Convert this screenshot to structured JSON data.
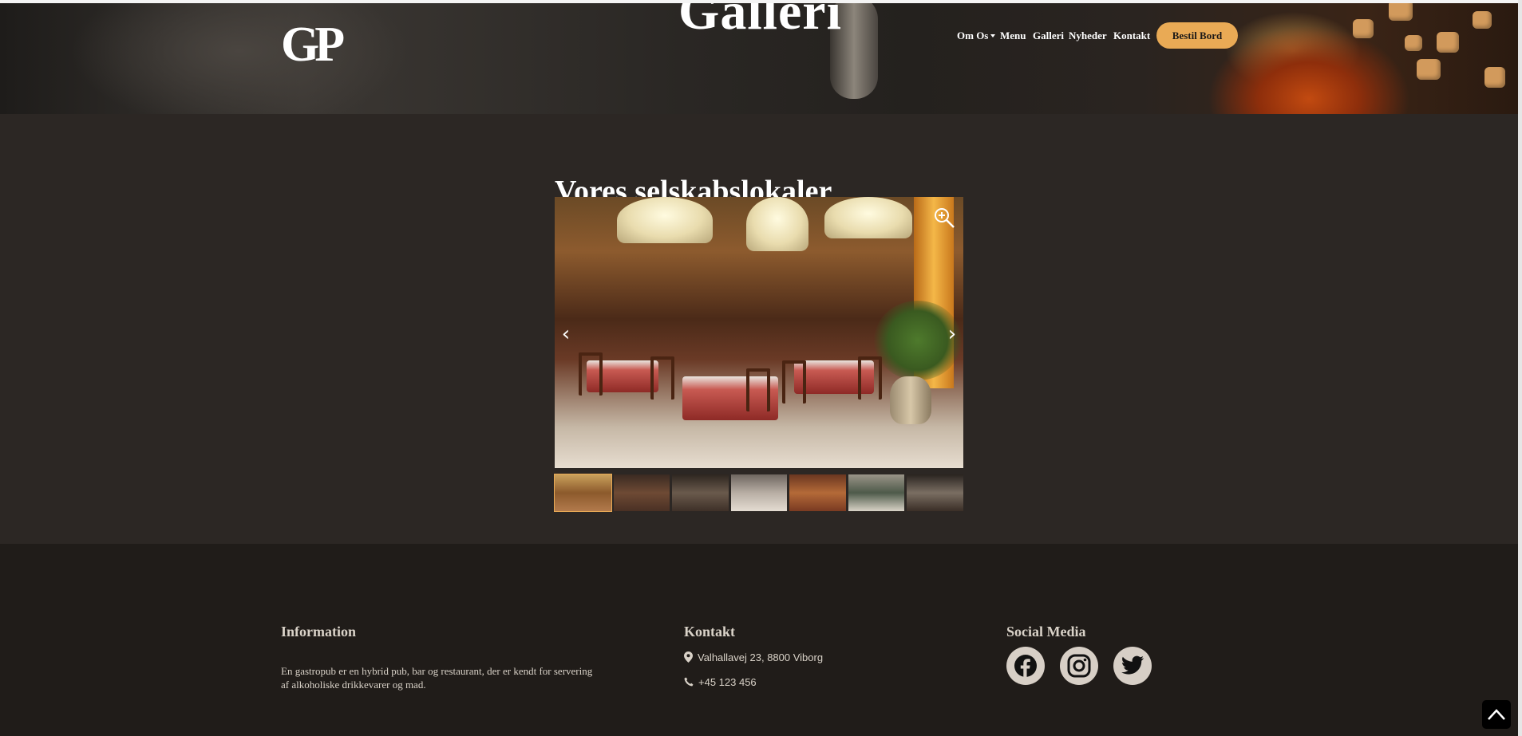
{
  "header": {
    "logo_text": "GP",
    "page_title": "Galleri",
    "nav": [
      {
        "label": "Om Os",
        "has_dropdown": true
      },
      {
        "label": "Menu"
      },
      {
        "label": "Galleri"
      },
      {
        "label": "Nyheder"
      },
      {
        "label": "Kontakt"
      }
    ],
    "cta_label": "Bestil Bord",
    "cta_color": "#e9aa55"
  },
  "gallery": {
    "title": "Vores selskabslokaler",
    "thumbnail_count": 7,
    "zoom_icon": "magnifier-plus-icon",
    "prev_icon": "chevron-left-icon",
    "next_icon": "chevron-right-icon"
  },
  "footer": {
    "information": {
      "heading": "Information",
      "text": "En gastropub er en hybrid pub, bar og restaurant, der er kendt for servering af alkoholiske drikkevarer og mad."
    },
    "contact": {
      "heading": "Kontakt",
      "address": "Valhallavej 23, 8800 Viborg",
      "phone": "+45 123 456",
      "address_icon": "map-pin-icon",
      "phone_icon": "phone-icon"
    },
    "social": {
      "heading": "Social Media",
      "icons": [
        "facebook-icon",
        "instagram-icon",
        "twitter-icon"
      ]
    }
  },
  "colors": {
    "page_bg": "#2c2724",
    "footer_bg": "#201c19",
    "accent": "#e9aa55",
    "footer_text": "#d9d2c8"
  }
}
